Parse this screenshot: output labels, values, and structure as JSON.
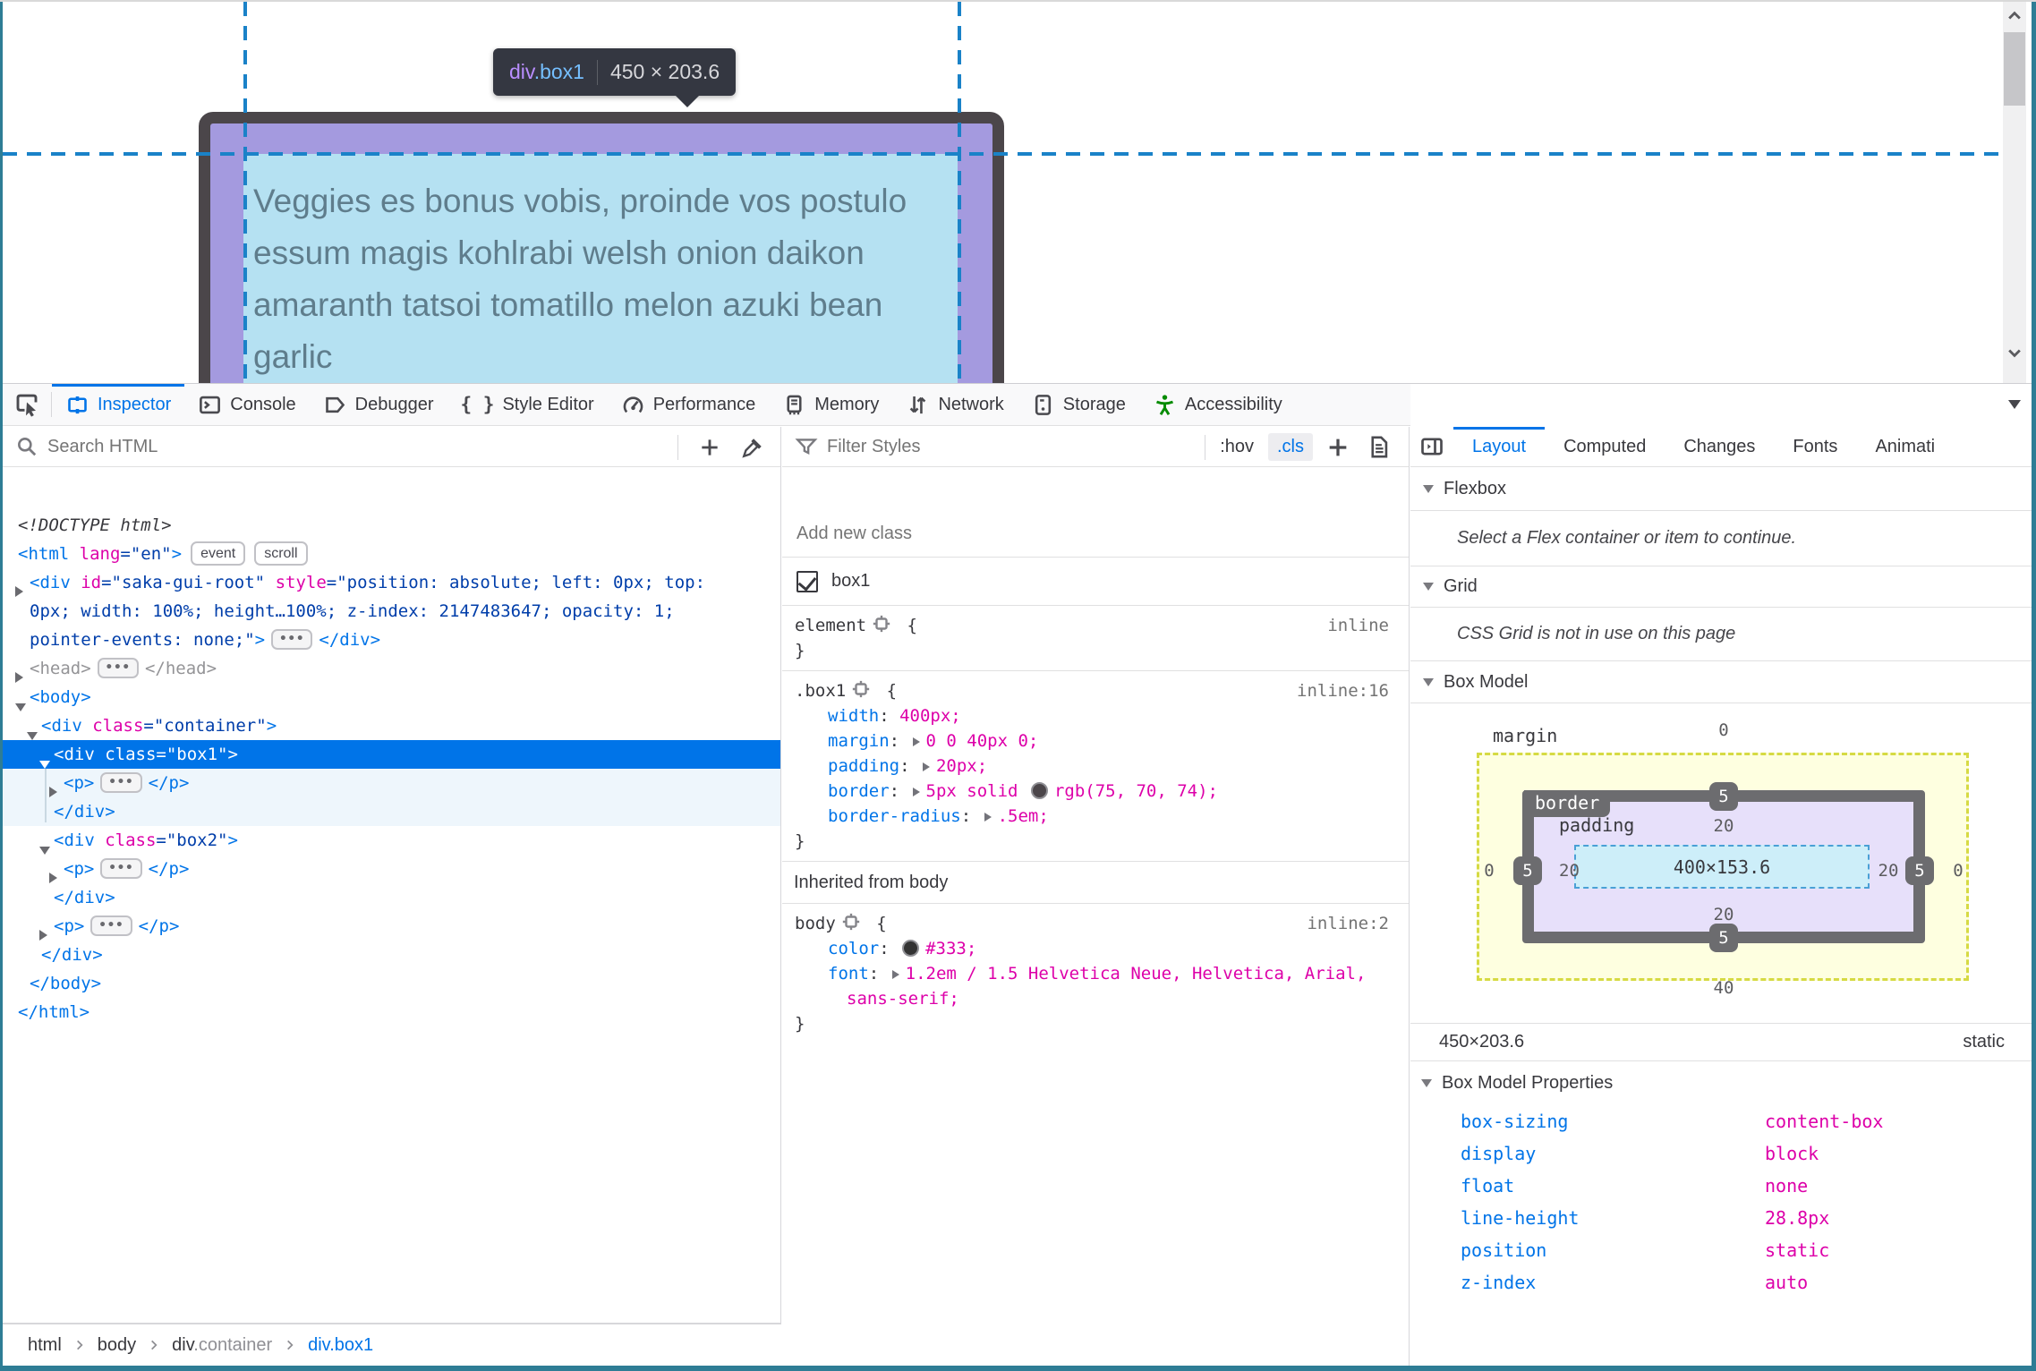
{
  "colors": {
    "accent_blue": "#0074e8",
    "selection_blue": "#0074e8",
    "attr_magenta": "#dd00a9",
    "attr_value_navy": "#003eaa",
    "guide_blue": "#1a82c8",
    "highlight_padding_purple": "#a49adf",
    "highlight_content_blue": "#b5e1f2",
    "box_border": "#4b464a",
    "window_frame_teal": "#2e7d95",
    "accessibility_green": "#058b00"
  },
  "page": {
    "tooltip": {
      "tag": "div",
      "class": ".box1",
      "dimensions": "450 × 203.6"
    },
    "content_lines": [
      "Veggies es bonus vobis, proinde vos postulo",
      "essum magis kohlrabi welsh onion daikon",
      "amaranth tatsoi tomatillo melon azuki bean",
      "garlic"
    ]
  },
  "toolbar": {
    "picker_icon": "node-picker-icon",
    "tabs": [
      {
        "label": "Inspector",
        "icon": "inspector-icon",
        "active": true
      },
      {
        "label": "Console",
        "icon": "console-icon",
        "active": false
      },
      {
        "label": "Debugger",
        "icon": "debugger-icon",
        "active": false
      },
      {
        "label": "Style Editor",
        "icon": "style-editor-icon",
        "active": false
      },
      {
        "label": "Performance",
        "icon": "performance-icon",
        "active": false
      },
      {
        "label": "Memory",
        "icon": "memory-icon",
        "active": false
      },
      {
        "label": "Network",
        "icon": "network-icon",
        "active": false
      },
      {
        "label": "Storage",
        "icon": "storage-icon",
        "active": false
      },
      {
        "label": "Accessibility",
        "icon": "accessibility-icon",
        "active": false,
        "green": true
      }
    ],
    "window_icons": [
      "responsive-icon",
      "meatball-icon",
      "close-icon"
    ]
  },
  "markup": {
    "search_placeholder": "Search HTML",
    "toolbar_icons": [
      "add-node-icon",
      "eyedropper-icon"
    ],
    "rows": [
      {
        "indent": 17,
        "tokens": [
          {
            "t": "<!DOCTYPE html>",
            "c": "doc"
          }
        ]
      },
      {
        "indent": 17,
        "tokens": [
          {
            "t": "<html ",
            "c": "tag"
          },
          {
            "t": "lang",
            "c": "attr"
          },
          {
            "t": "=\"en\"",
            "c": "val"
          },
          {
            "t": ">",
            "c": "tag"
          },
          {
            "badge": "event"
          },
          {
            "badge": "scroll"
          }
        ]
      },
      {
        "indent": 30,
        "arrow": "collapsed",
        "tokens": [
          {
            "t": "<div ",
            "c": "tag"
          },
          {
            "t": "id",
            "c": "attr"
          },
          {
            "t": "=\"saka-gui-root\" ",
            "c": "val"
          },
          {
            "t": "style",
            "c": "attr"
          },
          {
            "t": "=\"position: absolute; left: 0px; top:",
            "c": "val"
          }
        ]
      },
      {
        "indent": 30,
        "tokens": [
          {
            "t": "0px; width: 100%; height…100%; z-index: 2147483647; opacity: 1;",
            "c": "val"
          }
        ]
      },
      {
        "indent": 30,
        "tokens": [
          {
            "t": "pointer-events: none;\"",
            "c": "val"
          },
          {
            "t": ">",
            "c": "tag"
          },
          {
            "dots": true
          },
          {
            "t": "</div>",
            "c": "tag"
          }
        ]
      },
      {
        "indent": 30,
        "arrow": "collapsed",
        "tokens": [
          {
            "t": "<head>",
            "c": "gray"
          },
          {
            "dots": true
          },
          {
            "t": "</head>",
            "c": "gray"
          }
        ]
      },
      {
        "indent": 30,
        "arrow": "expanded",
        "tokens": [
          {
            "t": "<body>",
            "c": "tag"
          }
        ]
      },
      {
        "indent": 43,
        "arrow": "expanded",
        "tokens": [
          {
            "t": "<div ",
            "c": "tag"
          },
          {
            "t": "class",
            "c": "attr"
          },
          {
            "t": "=\"container\"",
            "c": "val"
          },
          {
            "t": ">",
            "c": "tag"
          }
        ]
      },
      {
        "indent": 57,
        "arrow": "expanded",
        "selected": true,
        "tokens": [
          {
            "t": "<div ",
            "c": "tag"
          },
          {
            "t": "class",
            "c": "attr"
          },
          {
            "t": "=\"box1\"",
            "c": "val"
          },
          {
            "t": ">",
            "c": "tag"
          }
        ]
      },
      {
        "indent": 68,
        "arrow": "collapsed",
        "shaded": true,
        "tokens": [
          {
            "t": "<p>",
            "c": "tag"
          },
          {
            "dots": true
          },
          {
            "t": "</p>",
            "c": "tag"
          }
        ]
      },
      {
        "indent": 57,
        "shaded": true,
        "tokens": [
          {
            "t": "</div>",
            "c": "tag"
          }
        ]
      },
      {
        "indent": 57,
        "arrow": "expanded",
        "tokens": [
          {
            "t": "<div ",
            "c": "tag"
          },
          {
            "t": "class",
            "c": "attr"
          },
          {
            "t": "=\"box2\"",
            "c": "val"
          },
          {
            "t": ">",
            "c": "tag"
          }
        ]
      },
      {
        "indent": 68,
        "arrow": "collapsed",
        "tokens": [
          {
            "t": "<p>",
            "c": "tag"
          },
          {
            "dots": true
          },
          {
            "t": "</p>",
            "c": "tag"
          }
        ]
      },
      {
        "indent": 57,
        "tokens": [
          {
            "t": "</div>",
            "c": "tag"
          }
        ]
      },
      {
        "indent": 57,
        "arrow": "collapsed",
        "tokens": [
          {
            "t": "<p>",
            "c": "tag"
          },
          {
            "dots": true
          },
          {
            "t": "</p>",
            "c": "tag"
          }
        ]
      },
      {
        "indent": 43,
        "tokens": [
          {
            "t": "</div>",
            "c": "tag"
          }
        ]
      },
      {
        "indent": 30,
        "tokens": [
          {
            "t": "</body>",
            "c": "tag"
          }
        ]
      },
      {
        "indent": 17,
        "tokens": [
          {
            "t": "</html>",
            "c": "tag"
          }
        ]
      }
    ],
    "breadcrumb": [
      {
        "label": "html"
      },
      {
        "label": "body"
      },
      {
        "label": "div",
        "suffix": ".container"
      },
      {
        "label": "div.box1",
        "active": true
      }
    ]
  },
  "rules": {
    "filter_placeholder": "Filter Styles",
    "pseudo_button": ":hov",
    "class_button": ".cls",
    "add_rule_icon": "add-rule-icon",
    "print_icon": "print-media-icon",
    "add_class_placeholder": "Add new class",
    "class_toggle": {
      "checked": true,
      "label": "box1"
    },
    "blocks": [
      {
        "type": "rule",
        "selector": "element",
        "link": "inline",
        "props": []
      },
      {
        "type": "rule",
        "selector": ".box1",
        "link": "inline:16",
        "props": [
          {
            "name": "width",
            "value": "400px;"
          },
          {
            "name": "margin",
            "expander": true,
            "value": "0 0 40px 0;"
          },
          {
            "name": "padding",
            "expander": true,
            "value": "20px;"
          },
          {
            "name": "border",
            "expander": true,
            "value": "5px solid",
            "swatch": "#4b464a",
            "value2": "rgb(75, 70, 74);"
          },
          {
            "name": "border-radius",
            "expander": true,
            "value": ".5em;"
          }
        ]
      },
      {
        "type": "header",
        "label": "Inherited from body"
      },
      {
        "type": "rule",
        "selector": "body",
        "link": "inline:2",
        "props": [
          {
            "name": "color",
            "swatch": "#333333",
            "value": "#333;"
          },
          {
            "name": "font",
            "expander": true,
            "value": "1.2em / 1.5 Helvetica Neue, Helvetica, Arial,",
            "wrap": "sans-serif;"
          }
        ]
      }
    ]
  },
  "layout": {
    "expand_icon": "expand-sidebar-icon",
    "tabs": [
      {
        "label": "Layout",
        "active": true
      },
      {
        "label": "Computed",
        "active": false
      },
      {
        "label": "Changes",
        "active": false
      },
      {
        "label": "Fonts",
        "active": false
      },
      {
        "label": "Animati",
        "active": false
      }
    ],
    "sections": {
      "flexbox": {
        "title": "Flexbox",
        "message": "Select a Flex container or item to continue."
      },
      "grid": {
        "title": "Grid",
        "message": "CSS Grid is not in use on this page"
      },
      "box_model": {
        "title": "Box Model"
      }
    },
    "box_model": {
      "margin_label": "margin",
      "border_label": "border",
      "padding_label": "padding",
      "content": "400×153.6",
      "margin": {
        "top": "0",
        "right": "0",
        "bottom": "40",
        "left": "0"
      },
      "border": {
        "top": "5",
        "right": "5",
        "bottom": "5",
        "left": "5"
      },
      "padding": {
        "top": "20",
        "right": "20",
        "bottom": "20",
        "left": "20"
      },
      "dimensions": "450×203.6",
      "position": "static"
    },
    "properties_title": "Box Model Properties",
    "properties": [
      {
        "name": "box-sizing",
        "value": "content-box"
      },
      {
        "name": "display",
        "value": "block"
      },
      {
        "name": "float",
        "value": "none"
      },
      {
        "name": "line-height",
        "value": "28.8px"
      },
      {
        "name": "position",
        "value": "static"
      },
      {
        "name": "z-index",
        "value": "auto"
      }
    ]
  }
}
